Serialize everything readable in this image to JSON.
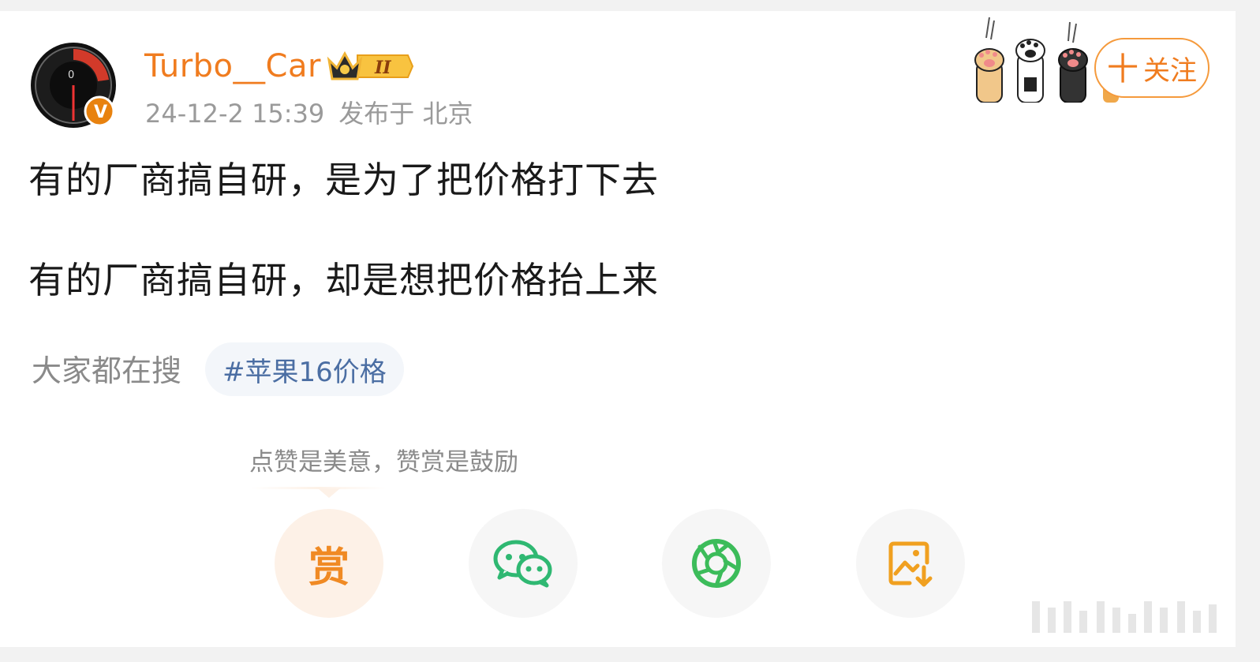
{
  "post": {
    "username": "Turbo__Car",
    "badge_level": "II",
    "timestamp": "24-12-2 15:39",
    "location": "发布于 北京",
    "follow_label": "关注",
    "follow_plus": "十",
    "content_lines": [
      "有的厂商搞自研，是为了把价格打下去",
      "有的厂商搞自研，却是想把价格抬上来"
    ]
  },
  "trending": {
    "label": "大家都在搜",
    "tag": "#苹果16价格"
  },
  "actions": {
    "tip": "点赞是美意，赞赏是鼓励",
    "reward_label": "赏",
    "icons": [
      "reward-icon",
      "wechat-icon",
      "moments-icon",
      "save-image-icon"
    ]
  },
  "colors": {
    "username": "#f07c1f",
    "accent": "#f59a3c",
    "tag_text": "#4b6ea3",
    "wechat_green": "#2fb872",
    "save_orange": "#f0a020"
  }
}
